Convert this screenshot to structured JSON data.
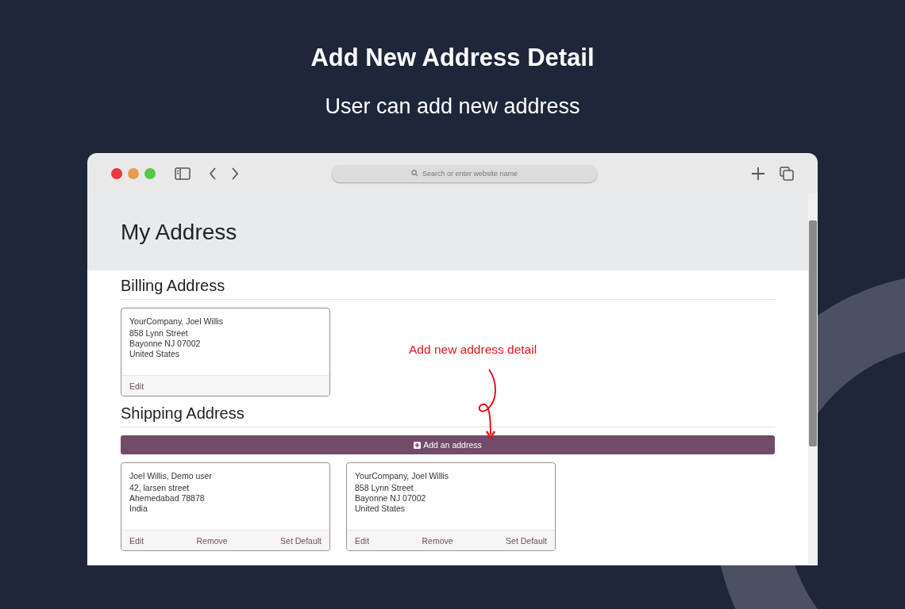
{
  "hero": {
    "title": "Add New Address Detail",
    "subtitle": "User can add new address"
  },
  "browser": {
    "search_placeholder": "Search or enter website name"
  },
  "page": {
    "title": "My Address",
    "billing": {
      "heading": "Billing Address",
      "cards": [
        {
          "lines": [
            "YourCompany, Joel Willis",
            "858 Lynn Street",
            "Bayonne NJ 07002",
            "United States"
          ],
          "actions": [
            "Edit"
          ]
        }
      ]
    },
    "shipping": {
      "heading": "Shipping Address",
      "add_button": "Add an address",
      "cards": [
        {
          "lines": [
            "Joel Willis, Demo user",
            "42, larsen street",
            "Ahemedabad 78878",
            "India"
          ],
          "actions": [
            "Edit",
            "Remove",
            "Set Default"
          ]
        },
        {
          "lines": [
            "YourCompany, Joel Willis",
            "858 Lynn Street",
            "Bayonne NJ 07002",
            "United States"
          ],
          "actions": [
            "Edit",
            "Remove",
            "Set Default"
          ]
        }
      ]
    }
  },
  "annotation": {
    "text": "Add new address detail"
  }
}
